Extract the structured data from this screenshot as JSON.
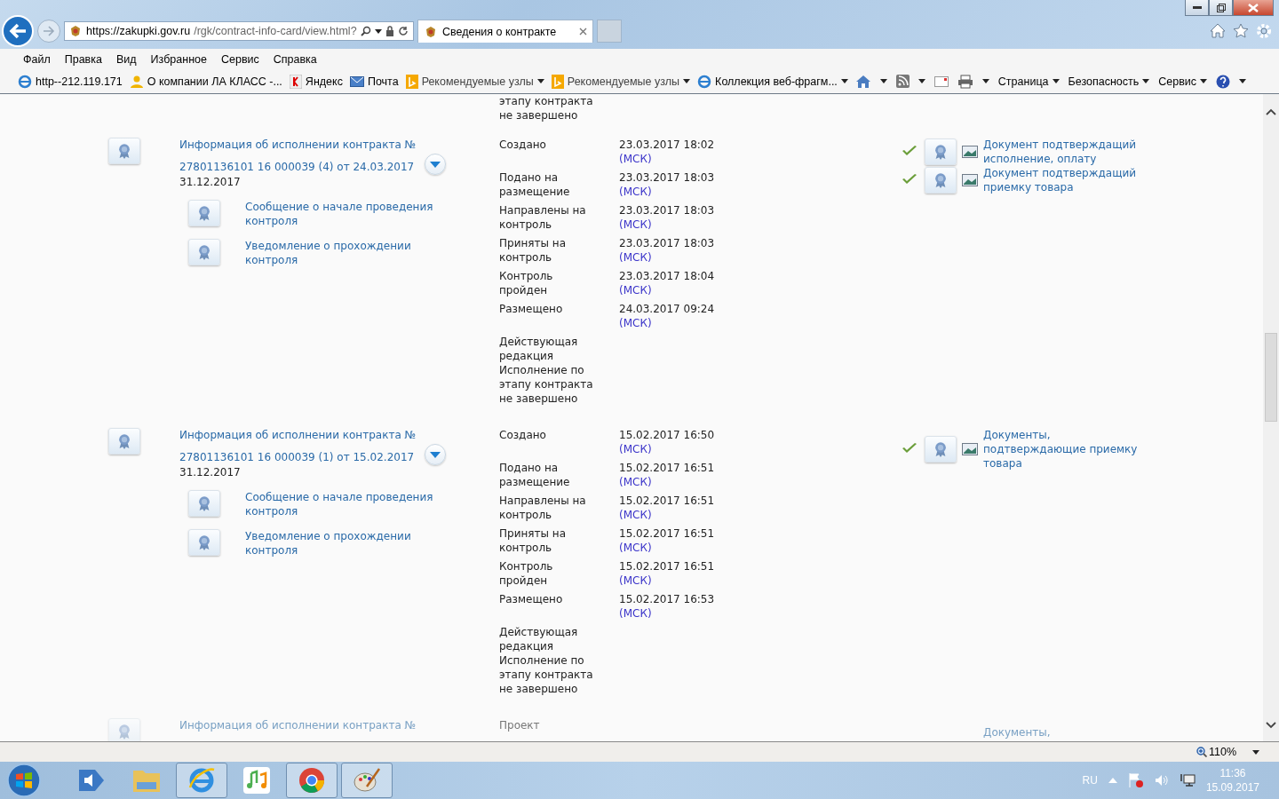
{
  "browser": {
    "address": {
      "host": "https://zakupki.gov.ru",
      "path": "/rgk/contract-info-card/view.html?"
    },
    "tab": {
      "title": "Сведения о контракте"
    }
  },
  "menu": [
    "Файл",
    "Правка",
    "Вид",
    "Избранное",
    "Сервис",
    "Справка"
  ],
  "favorites": [
    {
      "label": "http--212.119.171",
      "kind": "ie",
      "menu": false
    },
    {
      "label": "О компании ЛА КЛАСС -...",
      "kind": "person",
      "menu": false
    },
    {
      "label": "Яндекс",
      "kind": "yandex",
      "menu": false
    },
    {
      "label": "Почта",
      "kind": "mail",
      "menu": false
    },
    {
      "label": "Рекомендуемые узлы",
      "kind": "bing",
      "menu": true
    },
    {
      "label": "Рекомендуемые узлы",
      "kind": "bing",
      "menu": true
    },
    {
      "label": "Коллекция веб-фрагм...",
      "kind": "ie",
      "menu": true
    }
  ],
  "command_bar": [
    "Страница",
    "Безопасность",
    "Сервис"
  ],
  "page": {
    "top_fragment": [
      "этапу контракта",
      "не завершено"
    ],
    "records": [
      {
        "draft": false,
        "title": "Информация об исполнении контракта №",
        "number": "27801136101 16 000039 (4) от 24.03.2017",
        "date": "31.12.2017",
        "subitems": [
          "Сообщение о начале проведения контроля",
          "Уведомление о прохождении контроля"
        ],
        "events": [
          {
            "label": "Создано",
            "time": "23.03.2017 18:02",
            "zone": "(МСК)"
          },
          {
            "label": "Подано на размещение",
            "time": "23.03.2017 18:03",
            "zone": "(МСК)"
          },
          {
            "label": "Направлены на контроль",
            "time": "23.03.2017 18:03",
            "zone": "(МСК)"
          },
          {
            "label": "Приняты на контроль",
            "time": "23.03.2017 18:03",
            "zone": "(МСК)"
          },
          {
            "label": "Контроль пройден",
            "time": "23.03.2017 18:04",
            "zone": "(МСК)"
          },
          {
            "label": "Размещено",
            "time": "24.03.2017 09:24",
            "zone": "(МСК)"
          }
        ],
        "status": [
          "Действующая редакция",
          "Исполнение по этапу контракта не завершено"
        ],
        "documents": [
          {
            "title": "Документ подтверждащий исполнение, оплату",
            "checked": true
          },
          {
            "title": "Документ подтверждащий приемку товара",
            "checked": true
          }
        ]
      },
      {
        "draft": false,
        "title": "Информация об исполнении контракта №",
        "number": "27801136101 16 000039 (1) от 15.02.2017",
        "date": "31.12.2017",
        "subitems": [
          "Сообщение о начале проведения контроля",
          "Уведомление о прохождении контроля"
        ],
        "events": [
          {
            "label": "Создано",
            "time": "15.02.2017 16:50",
            "zone": "(МСК)"
          },
          {
            "label": "Подано на размещение",
            "time": "15.02.2017 16:51",
            "zone": "(МСК)"
          },
          {
            "label": "Направлены на контроль",
            "time": "15.02.2017 16:51",
            "zone": "(МСК)"
          },
          {
            "label": "Приняты на контроль",
            "time": "15.02.2017 16:51",
            "zone": "(МСК)"
          },
          {
            "label": "Контроль пройден",
            "time": "15.02.2017 16:51",
            "zone": "(МСК)"
          },
          {
            "label": "Размещено",
            "time": "15.02.2017 16:53",
            "zone": "(МСК)"
          }
        ],
        "status": [
          "Действующая редакция",
          "Исполнение по этапу контракта не завершено"
        ],
        "documents": [
          {
            "title": "Документы, подтверждающие приемку товара",
            "checked": true
          }
        ]
      },
      {
        "draft": true,
        "title": "Информация об исполнении контракта №",
        "events": [
          {
            "label": "Проект"
          }
        ],
        "documents": [
          {
            "title": "Документы,",
            "checked": false
          }
        ]
      }
    ]
  },
  "status_bar": {
    "zoom": "110%"
  },
  "taskbar": {
    "apps": [
      {
        "kind": "volume",
        "running": false
      },
      {
        "kind": "folder",
        "running": false
      },
      {
        "kind": "ie",
        "running": true
      },
      {
        "kind": "music",
        "running": false
      },
      {
        "kind": "chrome",
        "running": true
      },
      {
        "kind": "paint",
        "running": true
      }
    ],
    "language": "RU",
    "time": "11:36",
    "date": "15.09.2017"
  }
}
